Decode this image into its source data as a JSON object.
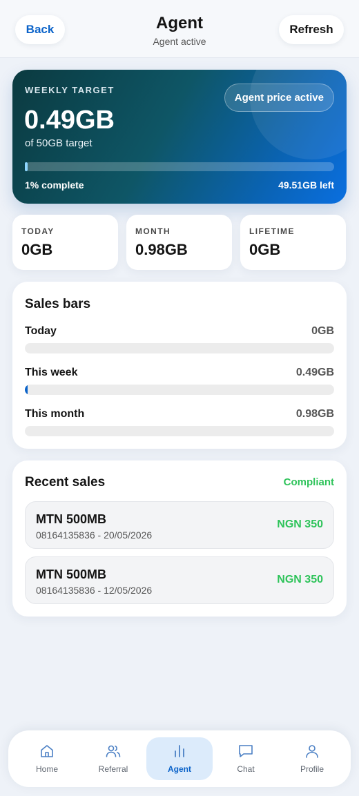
{
  "header": {
    "back_label": "Back",
    "title": "Agent",
    "subtitle": "Agent active",
    "refresh_label": "Refresh"
  },
  "hero": {
    "label": "WEEKLY TARGET",
    "badge": "Agent price active",
    "value": "0.49GB",
    "target_text": "of 50GB target",
    "progress_fraction": 0.0098,
    "complete_text": "1% complete",
    "left_text": "49.51GB left"
  },
  "stats": [
    {
      "label": "TODAY",
      "value": "0GB"
    },
    {
      "label": "MONTH",
      "value": "0.98GB"
    },
    {
      "label": "LIFETIME",
      "value": "0GB"
    }
  ],
  "sales_bars": {
    "title": "Sales bars",
    "rows": [
      {
        "name": "Today",
        "value": "0GB",
        "fraction": 0
      },
      {
        "name": "This week",
        "value": "0.49GB",
        "fraction": 0.0098
      },
      {
        "name": "This month",
        "value": "0.98GB",
        "fraction": 0.0
      }
    ]
  },
  "recent_sales": {
    "title": "Recent sales",
    "status": "Compliant",
    "items": [
      {
        "name": "MTN 500MB",
        "meta": "08164135836 - 20/05/2026",
        "amount": "NGN 350"
      },
      {
        "name": "MTN 500MB",
        "meta": "08164135836 - 12/05/2026",
        "amount": "NGN 350"
      }
    ]
  },
  "nav": {
    "items": [
      {
        "label": "Home",
        "icon": "home-icon"
      },
      {
        "label": "Referral",
        "icon": "users-icon"
      },
      {
        "label": "Agent",
        "icon": "bar-chart-icon"
      },
      {
        "label": "Chat",
        "icon": "chat-icon"
      },
      {
        "label": "Profile",
        "icon": "user-icon"
      }
    ],
    "active": "Agent"
  },
  "colors": {
    "accent": "#0b63c9",
    "success": "#2ec35a",
    "background": "#eef2f8"
  }
}
